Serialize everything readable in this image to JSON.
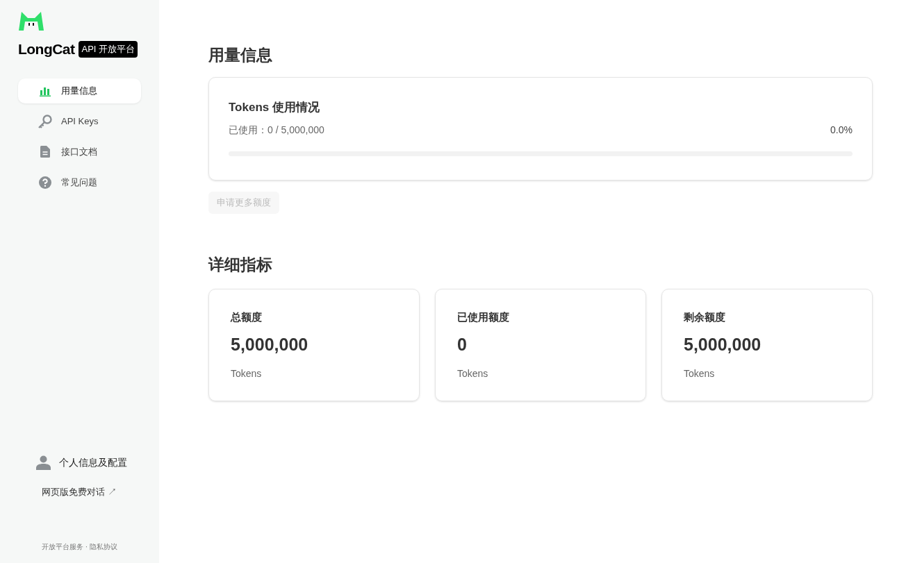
{
  "brand": {
    "name": "LongCat",
    "badge": "API 开放平台"
  },
  "nav": [
    {
      "label": "用量信息",
      "kind": "chart",
      "selected": true
    },
    {
      "label": "API Keys",
      "kind": "key",
      "selected": false
    },
    {
      "label": "接口文档",
      "kind": "doc",
      "selected": false
    },
    {
      "label": "常见问题",
      "kind": "help",
      "selected": false
    }
  ],
  "profile": {
    "label": "个人信息及配置"
  },
  "web_chat": {
    "label": "网页版免费对话",
    "arrow": "↗"
  },
  "footer": {
    "links": [
      "开放平台服务",
      "隐私协议"
    ],
    "separator": "·"
  },
  "usage": {
    "heading": "用量信息",
    "card_title": "Tokens 使用情况",
    "used": "已使用：0 / 5,000,000",
    "percent": "0.0%",
    "level": 0,
    "button": {
      "label": "申请更多额度",
      "disabled": true
    }
  },
  "metrics": {
    "heading": "详细指标",
    "cards": [
      {
        "label": "总额度",
        "value": "5,000,000",
        "unit": "Tokens"
      },
      {
        "label": "已使用额度",
        "value": "0",
        "unit": "Tokens"
      },
      {
        "label": "剩余额度",
        "value": "5,000,000",
        "unit": "Tokens"
      }
    ]
  }
}
